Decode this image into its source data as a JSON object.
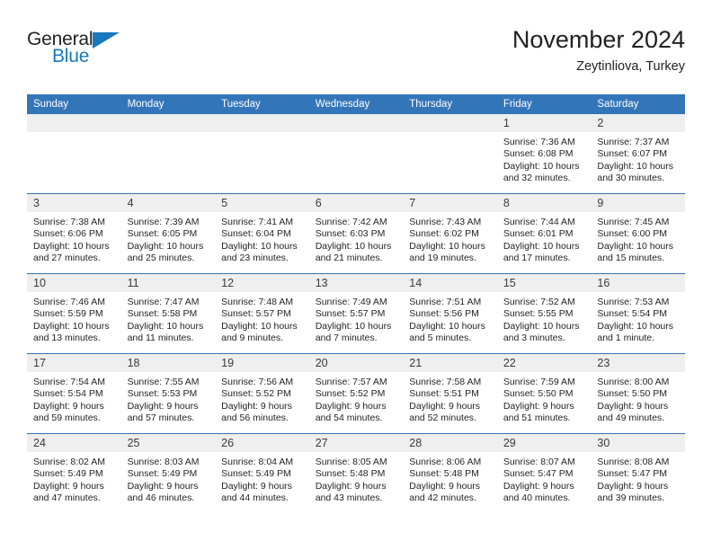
{
  "logo": {
    "word_one": "General",
    "word_two": "Blue",
    "triangle": "triangle-mark"
  },
  "header": {
    "month_title": "November 2024",
    "location": "Zeytinliova, Turkey"
  },
  "calendar": {
    "weekday_headers": [
      "Sunday",
      "Monday",
      "Tuesday",
      "Wednesday",
      "Thursday",
      "Friday",
      "Saturday"
    ],
    "accent_color": "#3375b9",
    "daynum_band_color": "#efefef",
    "labels": {
      "sunrise": "Sunrise:",
      "sunset": "Sunset:",
      "daylight": "Daylight:"
    },
    "weeks": [
      [
        {
          "day": "",
          "empty": true
        },
        {
          "day": "",
          "empty": true
        },
        {
          "day": "",
          "empty": true
        },
        {
          "day": "",
          "empty": true
        },
        {
          "day": "",
          "empty": true
        },
        {
          "day": "1",
          "sunrise": "Sunrise: 7:36 AM",
          "sunset": "Sunset: 6:08 PM",
          "daylight_1": "Daylight: 10 hours",
          "daylight_2": "and 32 minutes."
        },
        {
          "day": "2",
          "sunrise": "Sunrise: 7:37 AM",
          "sunset": "Sunset: 6:07 PM",
          "daylight_1": "Daylight: 10 hours",
          "daylight_2": "and 30 minutes."
        }
      ],
      [
        {
          "day": "3",
          "sunrise": "Sunrise: 7:38 AM",
          "sunset": "Sunset: 6:06 PM",
          "daylight_1": "Daylight: 10 hours",
          "daylight_2": "and 27 minutes."
        },
        {
          "day": "4",
          "sunrise": "Sunrise: 7:39 AM",
          "sunset": "Sunset: 6:05 PM",
          "daylight_1": "Daylight: 10 hours",
          "daylight_2": "and 25 minutes."
        },
        {
          "day": "5",
          "sunrise": "Sunrise: 7:41 AM",
          "sunset": "Sunset: 6:04 PM",
          "daylight_1": "Daylight: 10 hours",
          "daylight_2": "and 23 minutes."
        },
        {
          "day": "6",
          "sunrise": "Sunrise: 7:42 AM",
          "sunset": "Sunset: 6:03 PM",
          "daylight_1": "Daylight: 10 hours",
          "daylight_2": "and 21 minutes."
        },
        {
          "day": "7",
          "sunrise": "Sunrise: 7:43 AM",
          "sunset": "Sunset: 6:02 PM",
          "daylight_1": "Daylight: 10 hours",
          "daylight_2": "and 19 minutes."
        },
        {
          "day": "8",
          "sunrise": "Sunrise: 7:44 AM",
          "sunset": "Sunset: 6:01 PM",
          "daylight_1": "Daylight: 10 hours",
          "daylight_2": "and 17 minutes."
        },
        {
          "day": "9",
          "sunrise": "Sunrise: 7:45 AM",
          "sunset": "Sunset: 6:00 PM",
          "daylight_1": "Daylight: 10 hours",
          "daylight_2": "and 15 minutes."
        }
      ],
      [
        {
          "day": "10",
          "sunrise": "Sunrise: 7:46 AM",
          "sunset": "Sunset: 5:59 PM",
          "daylight_1": "Daylight: 10 hours",
          "daylight_2": "and 13 minutes."
        },
        {
          "day": "11",
          "sunrise": "Sunrise: 7:47 AM",
          "sunset": "Sunset: 5:58 PM",
          "daylight_1": "Daylight: 10 hours",
          "daylight_2": "and 11 minutes."
        },
        {
          "day": "12",
          "sunrise": "Sunrise: 7:48 AM",
          "sunset": "Sunset: 5:57 PM",
          "daylight_1": "Daylight: 10 hours",
          "daylight_2": "and 9 minutes."
        },
        {
          "day": "13",
          "sunrise": "Sunrise: 7:49 AM",
          "sunset": "Sunset: 5:57 PM",
          "daylight_1": "Daylight: 10 hours",
          "daylight_2": "and 7 minutes."
        },
        {
          "day": "14",
          "sunrise": "Sunrise: 7:51 AM",
          "sunset": "Sunset: 5:56 PM",
          "daylight_1": "Daylight: 10 hours",
          "daylight_2": "and 5 minutes."
        },
        {
          "day": "15",
          "sunrise": "Sunrise: 7:52 AM",
          "sunset": "Sunset: 5:55 PM",
          "daylight_1": "Daylight: 10 hours",
          "daylight_2": "and 3 minutes."
        },
        {
          "day": "16",
          "sunrise": "Sunrise: 7:53 AM",
          "sunset": "Sunset: 5:54 PM",
          "daylight_1": "Daylight: 10 hours",
          "daylight_2": "and 1 minute."
        }
      ],
      [
        {
          "day": "17",
          "sunrise": "Sunrise: 7:54 AM",
          "sunset": "Sunset: 5:54 PM",
          "daylight_1": "Daylight: 9 hours",
          "daylight_2": "and 59 minutes."
        },
        {
          "day": "18",
          "sunrise": "Sunrise: 7:55 AM",
          "sunset": "Sunset: 5:53 PM",
          "daylight_1": "Daylight: 9 hours",
          "daylight_2": "and 57 minutes."
        },
        {
          "day": "19",
          "sunrise": "Sunrise: 7:56 AM",
          "sunset": "Sunset: 5:52 PM",
          "daylight_1": "Daylight: 9 hours",
          "daylight_2": "and 56 minutes."
        },
        {
          "day": "20",
          "sunrise": "Sunrise: 7:57 AM",
          "sunset": "Sunset: 5:52 PM",
          "daylight_1": "Daylight: 9 hours",
          "daylight_2": "and 54 minutes."
        },
        {
          "day": "21",
          "sunrise": "Sunrise: 7:58 AM",
          "sunset": "Sunset: 5:51 PM",
          "daylight_1": "Daylight: 9 hours",
          "daylight_2": "and 52 minutes."
        },
        {
          "day": "22",
          "sunrise": "Sunrise: 7:59 AM",
          "sunset": "Sunset: 5:50 PM",
          "daylight_1": "Daylight: 9 hours",
          "daylight_2": "and 51 minutes."
        },
        {
          "day": "23",
          "sunrise": "Sunrise: 8:00 AM",
          "sunset": "Sunset: 5:50 PM",
          "daylight_1": "Daylight: 9 hours",
          "daylight_2": "and 49 minutes."
        }
      ],
      [
        {
          "day": "24",
          "sunrise": "Sunrise: 8:02 AM",
          "sunset": "Sunset: 5:49 PM",
          "daylight_1": "Daylight: 9 hours",
          "daylight_2": "and 47 minutes."
        },
        {
          "day": "25",
          "sunrise": "Sunrise: 8:03 AM",
          "sunset": "Sunset: 5:49 PM",
          "daylight_1": "Daylight: 9 hours",
          "daylight_2": "and 46 minutes."
        },
        {
          "day": "26",
          "sunrise": "Sunrise: 8:04 AM",
          "sunset": "Sunset: 5:49 PM",
          "daylight_1": "Daylight: 9 hours",
          "daylight_2": "and 44 minutes."
        },
        {
          "day": "27",
          "sunrise": "Sunrise: 8:05 AM",
          "sunset": "Sunset: 5:48 PM",
          "daylight_1": "Daylight: 9 hours",
          "daylight_2": "and 43 minutes."
        },
        {
          "day": "28",
          "sunrise": "Sunrise: 8:06 AM",
          "sunset": "Sunset: 5:48 PM",
          "daylight_1": "Daylight: 9 hours",
          "daylight_2": "and 42 minutes."
        },
        {
          "day": "29",
          "sunrise": "Sunrise: 8:07 AM",
          "sunset": "Sunset: 5:47 PM",
          "daylight_1": "Daylight: 9 hours",
          "daylight_2": "and 40 minutes."
        },
        {
          "day": "30",
          "sunrise": "Sunrise: 8:08 AM",
          "sunset": "Sunset: 5:47 PM",
          "daylight_1": "Daylight: 9 hours",
          "daylight_2": "and 39 minutes."
        }
      ]
    ]
  }
}
